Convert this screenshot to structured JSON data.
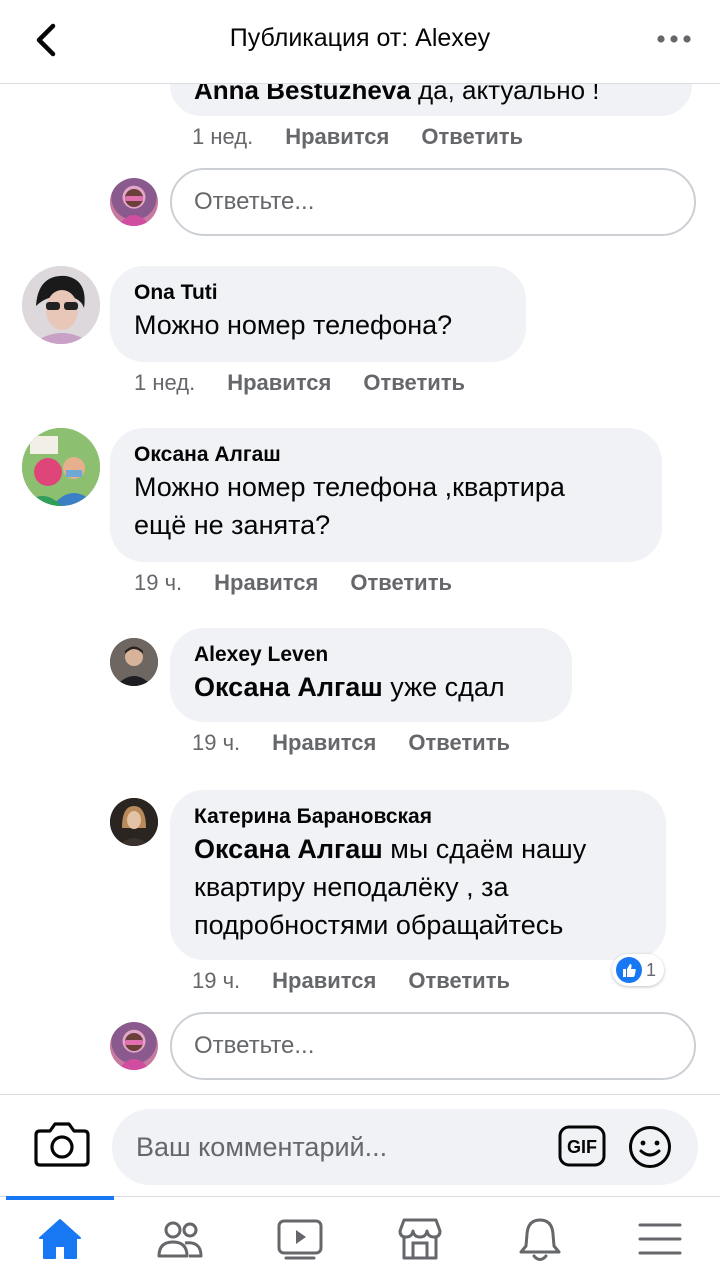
{
  "header": {
    "title": "Публикация от: Alexey"
  },
  "comments": {
    "top_reply": {
      "mention": "Anna Bestuzheva",
      "text": "да, актуально !",
      "time": "1 нед.",
      "like": "Нравится",
      "reply": "Ответить"
    },
    "reply_box_1": {
      "placeholder": "Ответьте..."
    },
    "ona": {
      "author": "Ona Tuti",
      "text": "Можно номер телефона?",
      "time": "1 нед.",
      "like": "Нравится",
      "reply": "Ответить"
    },
    "oksana": {
      "author": "Оксана Алгаш",
      "text_line1": "Можно номер телефона ,квартира",
      "text_line2": "ещё не занята?",
      "time": "19 ч.",
      "like": "Нравится",
      "reply": "Ответить"
    },
    "alexey": {
      "author": "Alexey Leven",
      "mention": "Оксана Алгаш",
      "text": "уже сдал",
      "time": "19 ч.",
      "like": "Нравится",
      "reply": "Ответить"
    },
    "katerina": {
      "author": "Катерина Барановская",
      "mention": "Оксана Алгаш",
      "text_line1": "мы сдаём нашу",
      "text_line2": "квартиру неподалёку , за",
      "text_line3": "подробностями обращайтесь",
      "time": "19 ч.",
      "like": "Нравится",
      "reply": "Ответить",
      "reaction_count": "1"
    },
    "reply_box_2": {
      "placeholder": "Ответьте..."
    }
  },
  "composer": {
    "placeholder": "Ваш комментарий...",
    "gif_label": "GIF"
  },
  "nav": {
    "items": [
      "home-icon",
      "friends-icon",
      "watch-icon",
      "marketplace-icon",
      "notifications-icon",
      "menu-icon"
    ],
    "active": "home-icon"
  },
  "colors": {
    "accent": "#1877f2",
    "bubble": "#f0f2f5",
    "secondary_text": "#65676b"
  }
}
